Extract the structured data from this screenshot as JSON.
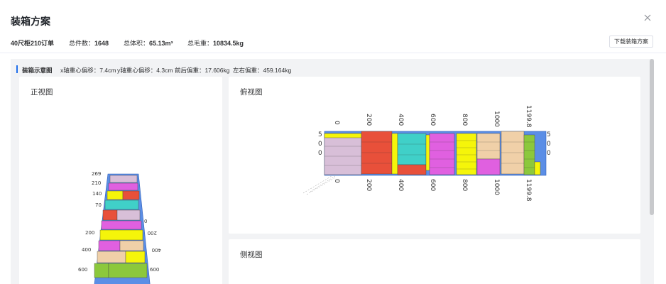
{
  "modal": {
    "title": "装箱方案",
    "close_icon": "close-icon"
  },
  "summary": {
    "container": "40尺柜210订单",
    "count_label": "总件数：",
    "count_value": "1648",
    "volume_label": "总体积：",
    "volume_value": "65.13m³",
    "weight_label": "总毛重：",
    "weight_value": "10834.5kg",
    "download_label": "下载装箱方案"
  },
  "section": {
    "title": "装箱示意图",
    "x_offset": "x轴重心偏移：7.4cm",
    "y_offset": "y轴重心偏移：4.3cm",
    "front_back": "前后偏重：17.606kg",
    "left_right": "左右偏重：459.164kg"
  },
  "views": {
    "front": "正视图",
    "top": "俯视图",
    "side": "侧视图"
  },
  "top_view_axis": {
    "ticks": [
      "0",
      "200",
      "400",
      "600",
      "800",
      "1000",
      "1199.8"
    ],
    "side_left": [
      "5",
      "0",
      "0"
    ],
    "side_right": [
      "5",
      "0",
      "0"
    ]
  },
  "front_view_axis": {
    "left_ticks": [
      "269",
      "210",
      "140",
      "70",
      "200",
      "400",
      "600"
    ],
    "right_ticks": [
      "0",
      "200",
      "400",
      "600"
    ]
  },
  "colors": {
    "accent": "#1f6feb",
    "container_blue": "#5b8ee6",
    "pink": "#d8bfd8",
    "red": "#e8503a",
    "yellow": "#f5f50a",
    "cyan": "#40d0c8",
    "magenta": "#e060e0",
    "tan": "#f0d0a8",
    "green": "#8cc83c"
  }
}
